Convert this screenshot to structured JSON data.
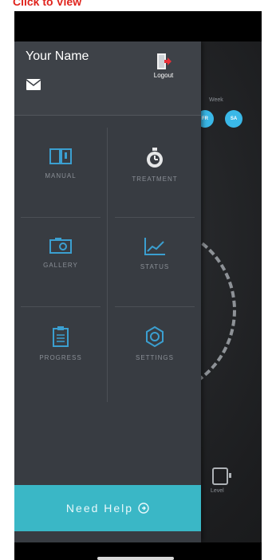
{
  "banner": {
    "text": "Click to View"
  },
  "drawer": {
    "user_name": "Your Name",
    "logout_label": "Logout",
    "menu": [
      {
        "label": "MANUAL",
        "icon": "book-icon"
      },
      {
        "label": "TREATMENT",
        "icon": "timer-icon"
      },
      {
        "label": "GALLERY",
        "icon": "camera-icon"
      },
      {
        "label": "STATUS",
        "icon": "chart-icon"
      },
      {
        "label": "PROGRESS",
        "icon": "clipboard-icon"
      },
      {
        "label": "SETTINGS",
        "icon": "gear-icon"
      }
    ],
    "help_label": "Need Help"
  },
  "background": {
    "week_label": "Week",
    "day_badges": [
      "FR",
      "SA"
    ],
    "level_label": "Level"
  },
  "colors": {
    "accent": "#3ab7c6",
    "drawer": "#383c42",
    "icon": "#3b9fd0",
    "logout": "#e8313a",
    "banner": "#e0231c"
  }
}
